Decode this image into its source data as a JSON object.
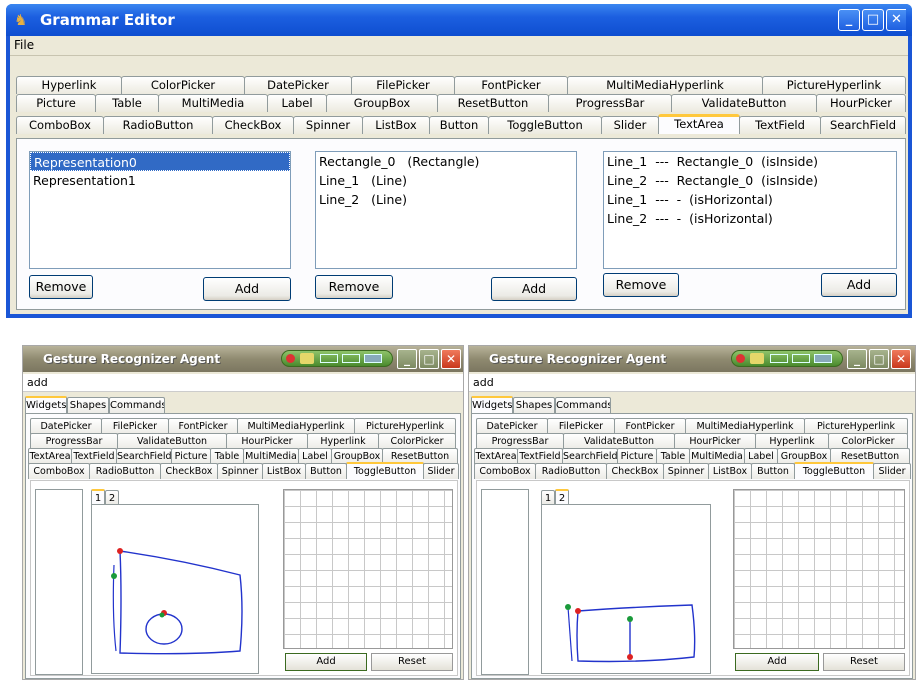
{
  "grammar_editor": {
    "title": "Grammar Editor",
    "menu": "File",
    "tabs_row1": [
      "Hyperlink",
      "ColorPicker",
      "DatePicker",
      "FilePicker",
      "FontPicker",
      "MultiMediaHyperlink",
      "PictureHyperlink"
    ],
    "tabs_row2": [
      "Picture",
      "Table",
      "MultiMedia",
      "Label",
      "GroupBox",
      "ResetButton",
      "ProgressBar",
      "ValidateButton",
      "HourPicker"
    ],
    "tabs_row3": [
      "ComboBox",
      "RadioButton",
      "CheckBox",
      "Spinner",
      "ListBox",
      "Button",
      "ToggleButton",
      "Slider",
      "TextArea",
      "TextField",
      "SearchField"
    ],
    "selected_tab": "TextArea",
    "representations": [
      "Representation0",
      "Representation1"
    ],
    "shapes": [
      "Rectangle_0   (Rectangle)",
      "Line_1   (Line)",
      "Line_2   (Line)"
    ],
    "constraints": [
      "Line_1  ---  Rectangle_0  (isInside)",
      "Line_2  ---  Rectangle_0  (isInside)",
      "Line_1  ---  -  (isHorizontal)",
      "Line_2  ---  -  (isHorizontal)"
    ],
    "remove_label": "Remove",
    "add_label": "Add"
  },
  "agents": [
    {
      "title": "Gesture Recognizer Agent",
      "menu": "add",
      "main_tabs": [
        "Widgets",
        "Shapes",
        "Commands"
      ],
      "tabs_row1": [
        "DatePicker",
        "FilePicker",
        "FontPicker",
        "MultiMediaHyperlink",
        "PictureHyperlink"
      ],
      "tabs_row2": [
        "ProgressBar",
        "ValidateButton",
        "HourPicker",
        "Hyperlink",
        "ColorPicker"
      ],
      "tabs_row3": [
        "TextArea",
        "TextField",
        "SearchField",
        "Picture",
        "Table",
        "MultiMedia",
        "Label",
        "GroupBox",
        "ResetButton"
      ],
      "tabs_row4": [
        "ComboBox",
        "RadioButton",
        "CheckBox",
        "Spinner",
        "ListBox",
        "Button",
        "ToggleButton",
        "Slider"
      ],
      "selected_tab": "ToggleButton",
      "rep_tabs": [
        "1",
        "2"
      ],
      "add_label": "Add",
      "reset_label": "Reset"
    },
    {
      "title": "Gesture Recognizer Agent",
      "menu": "add",
      "main_tabs": [
        "Widgets",
        "Shapes",
        "Commands"
      ],
      "tabs_row1": [
        "DatePicker",
        "FilePicker",
        "FontPicker",
        "MultiMediaHyperlink",
        "PictureHyperlink"
      ],
      "tabs_row2": [
        "ProgressBar",
        "ValidateButton",
        "HourPicker",
        "Hyperlink",
        "ColorPicker"
      ],
      "tabs_row3": [
        "TextArea",
        "TextField",
        "SearchField",
        "Picture",
        "Table",
        "MultiMedia",
        "Label",
        "GroupBox",
        "ResetButton"
      ],
      "tabs_row4": [
        "ComboBox",
        "RadioButton",
        "CheckBox",
        "Spinner",
        "ListBox",
        "Button",
        "ToggleButton",
        "Slider"
      ],
      "selected_tab": "ToggleButton",
      "rep_tabs": [
        "1",
        "2"
      ],
      "add_label": "Add",
      "reset_label": "Reset"
    }
  ],
  "colors": {
    "xp_blue": "#1c5fe0",
    "selection": "#316ac5",
    "tab_highlight": "#ffc83c",
    "stroke": "#2233cc"
  }
}
